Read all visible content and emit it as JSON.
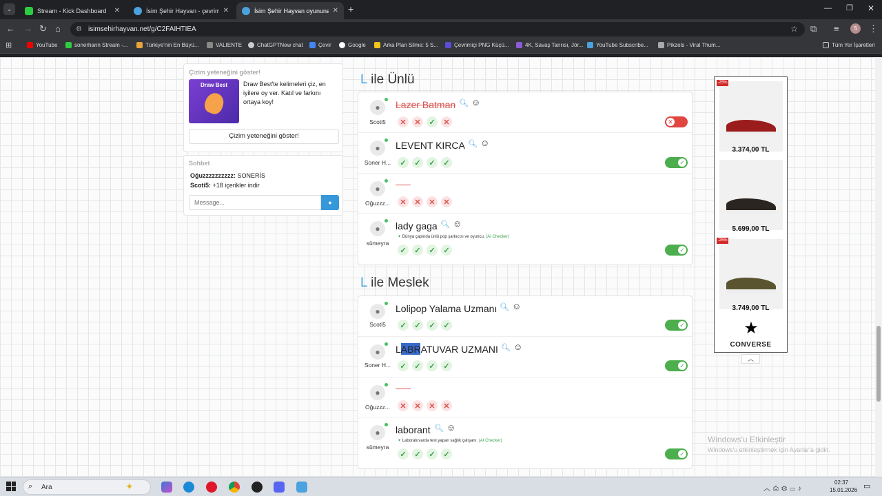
{
  "browser": {
    "tabs": [
      {
        "label": "Stream - Kick Dashboard",
        "close": "✕"
      },
      {
        "label": "İsim Şehir Hayvan - çevrimiçi oy",
        "close": "✕"
      },
      {
        "label": "İsim Şehir Hayvan oyununa katı",
        "close": "✕"
      }
    ],
    "new_tab": "+",
    "url": "isimsehirhayvan.net/g/C2FAIHTIEA",
    "bookmarks": [
      "YouTube",
      "sonerhann Stream -...",
      "Türkiye'nin En Büyü...",
      "VALIENTE",
      "ChatGPTNew chat",
      "Çevir",
      "Google",
      "Arka Plan Silme: 5 S...",
      "Çevrimiçi PNG Küçü...",
      "4K, Savaş Tanrısı, Jör...",
      "YouTube Subscribe...",
      "Pikzels - Viral Thum..."
    ],
    "all_bookmarks": "Tüm Yer İşaretleri",
    "profile": "S"
  },
  "draw": {
    "title": "Çizim yeteneğini göster!",
    "thumb_label": "Draw Best",
    "text": "Draw Best'te kelimeleri çiz, en iyilere oy ver. Katıl ve farkını ortaya koy!",
    "button": "Çizim yeteneğini göster!"
  },
  "chat": {
    "title": "Sohbet",
    "messages": [
      {
        "user": "Oğuzzzzzzzzzz:",
        "text": " SONERİS"
      },
      {
        "user": "Scoti5:",
        "text": " +18 içerikler indir"
      }
    ],
    "placeholder": "Message..."
  },
  "sections": [
    {
      "letter": "L",
      "title": " ile Ünlü",
      "rows": [
        {
          "user": "Scoti5",
          "word": "Lazer Batman",
          "state": "bad",
          "marks": [
            "no",
            "no",
            "ok",
            "no"
          ],
          "toggle": "off"
        },
        {
          "user": "Soner H...",
          "word": "LEVENT KIRCA",
          "state": "ok",
          "marks": [
            "ok",
            "ok",
            "ok",
            "ok"
          ],
          "toggle": "on"
        },
        {
          "user": "Oğuzzz...",
          "word": "",
          "state": "empty",
          "marks": [
            "no",
            "no",
            "no",
            "no"
          ],
          "toggle": ""
        },
        {
          "user": "sümeyra",
          "word": "lady gaga",
          "state": "ok",
          "hint": "Dünya çapında ünlü pop şarkıcısı ve oyuncu.",
          "hint_tag": "(AI Checker)",
          "marks": [
            "ok",
            "ok",
            "ok",
            "ok"
          ],
          "toggle": "on"
        }
      ]
    },
    {
      "letter": "L",
      "title": " ile Meslek",
      "rows": [
        {
          "user": "Scoti5",
          "word": "Lolipop Yalama Uzmanı",
          "state": "ok",
          "marks": [
            "ok",
            "ok",
            "ok",
            "ok"
          ],
          "toggle": "on"
        },
        {
          "user": "Soner H...",
          "word": "LABRATUVAR UZMANI",
          "state": "ok",
          "marks": [
            "ok",
            "ok",
            "ok",
            "ok"
          ],
          "toggle": "on"
        },
        {
          "user": "Oğuzzz...",
          "word": "",
          "state": "empty",
          "marks": [
            "no",
            "no",
            "no",
            "no"
          ],
          "toggle": ""
        },
        {
          "user": "sümeyra",
          "word": "laborant",
          "state": "ok",
          "hint": "Laboratuvarda test yapan sağlık çalışanı.",
          "hint_tag": "(AI Checker)",
          "marks": [
            "ok",
            "ok",
            "ok",
            "ok"
          ],
          "toggle": "on"
        }
      ]
    }
  ],
  "ad": {
    "items": [
      {
        "discount": "-25%",
        "price": "3.374,00 TL"
      },
      {
        "discount": "",
        "price": "5.699,00 TL"
      },
      {
        "discount": "-25%",
        "price": "3.749,00 TL"
      }
    ],
    "brand": "CONVERSE"
  },
  "watermark": {
    "title": "Windows'u Etkinleştir",
    "sub": "Windows'u etkinleştirmek için Ayarlar'a gidin."
  },
  "taskbar": {
    "search": "Ara",
    "time": "02:37",
    "date": "15.01.2026"
  },
  "colors": {
    "accent": "#4aa3df",
    "ok": "#4cae4c",
    "bad": "#e0453f"
  }
}
